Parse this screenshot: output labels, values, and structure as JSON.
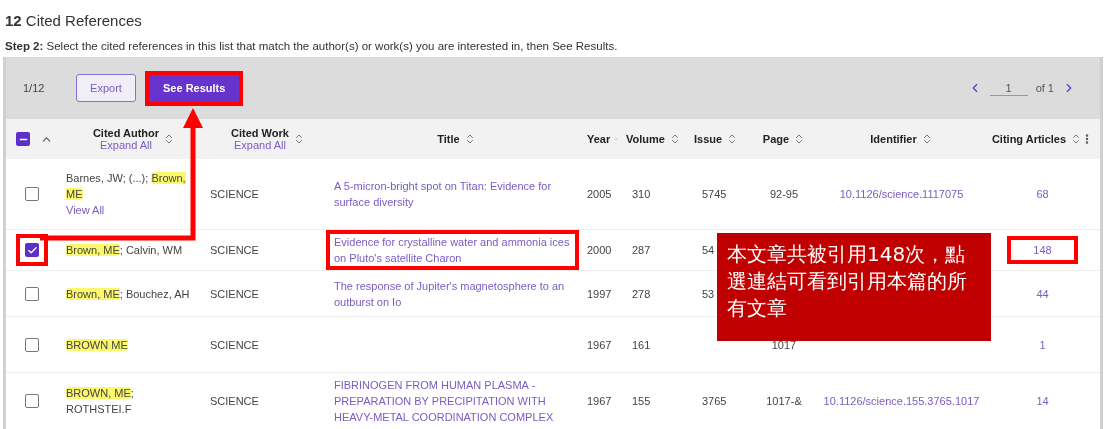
{
  "heading": {
    "count": "12",
    "text": "Cited References"
  },
  "step": {
    "label": "Step 2:",
    "text": "Select the cited references in this list that match the author(s) or work(s) you are interested in, then See Results."
  },
  "toolbar": {
    "selection": "1/12",
    "export": "Export",
    "see_results": {
      "label": "See Results",
      "annotated": true
    },
    "page": "1",
    "page_of": "of 1"
  },
  "table": {
    "select_all_partial": true,
    "columns": [
      {
        "label": "Cited Author",
        "link": "Expand All"
      },
      {
        "label": "Cited Work",
        "link": "Expand All"
      },
      {
        "label": "Title"
      },
      {
        "label": "Year"
      },
      {
        "label": "Volume"
      },
      {
        "label": "Issue"
      },
      {
        "label": "Page"
      },
      {
        "label": "Identifier"
      },
      {
        "label": "Citing Articles"
      }
    ],
    "rows": [
      {
        "checked": false,
        "check_annotated": false,
        "author": [
          {
            "text": "Barnes, JW; (...); ",
            "highlighted": false
          },
          {
            "text": "Brown, ME",
            "highlighted": true
          }
        ],
        "view_all": "View All",
        "work": "SCIENCE",
        "title": "A 5-micron-bright spot on Titan: Evidence for surface diversity",
        "title_annotated": false,
        "year": "2005",
        "volume": "310",
        "issue": "5745",
        "page": "92-95",
        "identifier": "10.1126/science.1117075",
        "citing": "68",
        "citing_annotated": false
      },
      {
        "checked": true,
        "check_annotated": true,
        "author": [
          {
            "text": "Brown, ME",
            "highlighted": true
          },
          {
            "text": "; Calvin, WM",
            "highlighted": false
          }
        ],
        "work": "SCIENCE",
        "title": "Evidence for crystalline water and ammonia ices on Pluto's satellite Charon",
        "title_annotated": true,
        "year": "2000",
        "volume": "287",
        "issue": "54",
        "citing": "148",
        "citing_annotated": true
      },
      {
        "checked": false,
        "check_annotated": false,
        "author": [
          {
            "text": "Brown, ME",
            "highlighted": true
          },
          {
            "text": "; Bouchez, AH",
            "highlighted": false
          }
        ],
        "work": "SCIENCE",
        "title": "The response of Jupiter's magnetosphere to an outburst on Io",
        "title_annotated": false,
        "year": "1997",
        "volume": "278",
        "issue": "53",
        "citing": "44",
        "citing_annotated": false
      },
      {
        "checked": false,
        "check_annotated": false,
        "author": [
          {
            "text": "BROWN ME",
            "highlighted": true
          }
        ],
        "work": "SCIENCE",
        "year": "1967",
        "volume": "161",
        "page": "1017",
        "citing": "1",
        "citing_annotated": false
      },
      {
        "checked": false,
        "check_annotated": false,
        "author": [
          {
            "text": "BROWN, ME",
            "highlighted": true
          },
          {
            "text": "; ROTHSTEI.F",
            "highlighted": false
          }
        ],
        "work": "SCIENCE",
        "title": "FIBRINOGEN FROM HUMAN PLASMA - PREPARATION BY PRECIPITATION WITH HEAVY-METAL COORDINATION COMPLEX",
        "title_annotated": false,
        "year": "1967",
        "volume": "155",
        "issue": "3765",
        "page": "1017-&",
        "identifier": "10.1126/science.155.3765.1017",
        "citing": "14",
        "citing_annotated": false
      }
    ]
  },
  "callout": {
    "text": "本文章共被引用148次，點選連結可看到引用本篇的所有文章"
  }
}
